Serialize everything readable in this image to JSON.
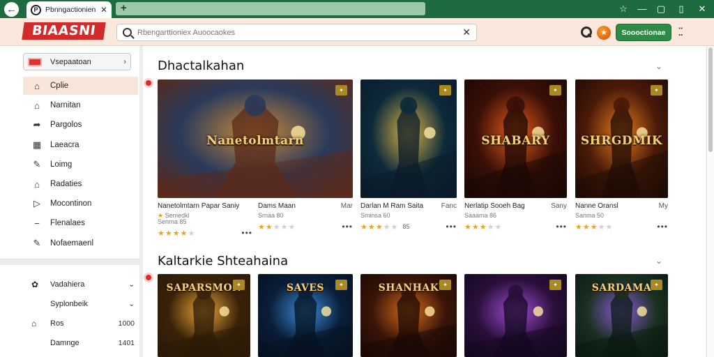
{
  "browser": {
    "tab_title": "Pbnngactionien",
    "tab_favicon": "P",
    "new_tab_symbol": "+",
    "window_buttons": [
      "☆",
      "—",
      "▢",
      "▯",
      "✕"
    ]
  },
  "header": {
    "logo": "BIAASNI",
    "search_placeholder": "Rbengarttioniex Auoocaokes",
    "cta_label": "Soooctionae",
    "coin_symbol": "★"
  },
  "sidebar": {
    "select_label": "Vsepaatoan",
    "items": [
      {
        "label": "Cplie",
        "icon": "home-icon",
        "glyph": "⌂",
        "active": true
      },
      {
        "label": "Narnitan",
        "icon": "house-icon",
        "glyph": "⌂"
      },
      {
        "label": "Pargolos",
        "icon": "share-icon",
        "glyph": "➦"
      },
      {
        "label": "Laeacra",
        "icon": "calendar-icon",
        "glyph": "▦"
      },
      {
        "label": "Loimg",
        "icon": "edit-box-icon",
        "glyph": "✎"
      },
      {
        "label": "Radaties",
        "icon": "home-icon",
        "glyph": "⌂"
      },
      {
        "label": "Mocontinon",
        "icon": "play-box-icon",
        "glyph": "▷"
      },
      {
        "label": "Flenalaes",
        "icon": "minus-box-icon",
        "glyph": "−"
      },
      {
        "label": "Nofaemaenl",
        "icon": "edit-icon",
        "glyph": "✎"
      }
    ],
    "items2": [
      {
        "label": "Vadahiera",
        "glyph": "✿",
        "right": "⌄"
      },
      {
        "label": "Syplonbeik",
        "glyph": "",
        "right": "⌄"
      },
      {
        "label": "Ros",
        "glyph": "⌂",
        "right": "1000"
      },
      {
        "label": "Damnge",
        "glyph": "",
        "right": "1401"
      }
    ]
  },
  "sections": [
    {
      "title": "Dhactalkahan",
      "cards": [
        {
          "title": "Nanetolmtarn Papar Saniy",
          "sub": "",
          "meta": "Semedkl",
          "meta2": "Senrna 85",
          "stars": 4,
          "count": "",
          "palette": [
            "#2a3a5a",
            "#c98a3a",
            "#5b2a1a"
          ],
          "art": "Nanetolmtarn"
        },
        {
          "title": "Dams Maan",
          "sub": "Mar",
          "meta": "",
          "meta2": "Srnaa 80",
          "stars": 2,
          "count": "",
          "palette": [
            "#7a4c2a",
            "#d4633a",
            "#2b1e1a"
          ],
          "art": ""
        },
        {
          "title": "Darlan M Ram Saita",
          "sub": "Fanc",
          "meta": "",
          "meta2": "Sminsa 60",
          "stars": 3,
          "count": "85",
          "palette": [
            "#0d2a3a",
            "#d7b248",
            "#0a1a2a"
          ],
          "art": ""
        },
        {
          "title": "Nerlatip Sooeh Bag",
          "sub": "Sany",
          "meta": "",
          "meta2": "Saaama 86",
          "stars": 3,
          "count": "",
          "palette": [
            "#3a0f08",
            "#e65c18",
            "#1a0804"
          ],
          "art": "SHABARY"
        },
        {
          "title": "Nanne Oransl",
          "sub": "My",
          "meta": "",
          "meta2": "Sanma 50",
          "stars": 3,
          "count": "",
          "palette": [
            "#4a1a08",
            "#e67a1c",
            "#1e0b04"
          ],
          "art": "SHRGDMIK"
        }
      ]
    },
    {
      "title": "Kaltarkie Shteahaina",
      "cards": [
        {
          "art": "SAPARSMON",
          "palette": [
            "#3a2208",
            "#e7a43a",
            "#2a1a06"
          ]
        },
        {
          "art": "SAVES",
          "palette": [
            "#0a1e3a",
            "#3a8bd4",
            "#05111f"
          ]
        },
        {
          "art": "SHANHAK",
          "palette": [
            "#3a1408",
            "#d46a1a",
            "#1a0804"
          ]
        },
        {
          "art": "",
          "palette": [
            "#2a0f3a",
            "#a04cd4",
            "#130820"
          ]
        },
        {
          "art": "SARDAMA",
          "palette": [
            "#1a3020",
            "#8a5ad4",
            "#0a1a12"
          ]
        }
      ]
    }
  ]
}
